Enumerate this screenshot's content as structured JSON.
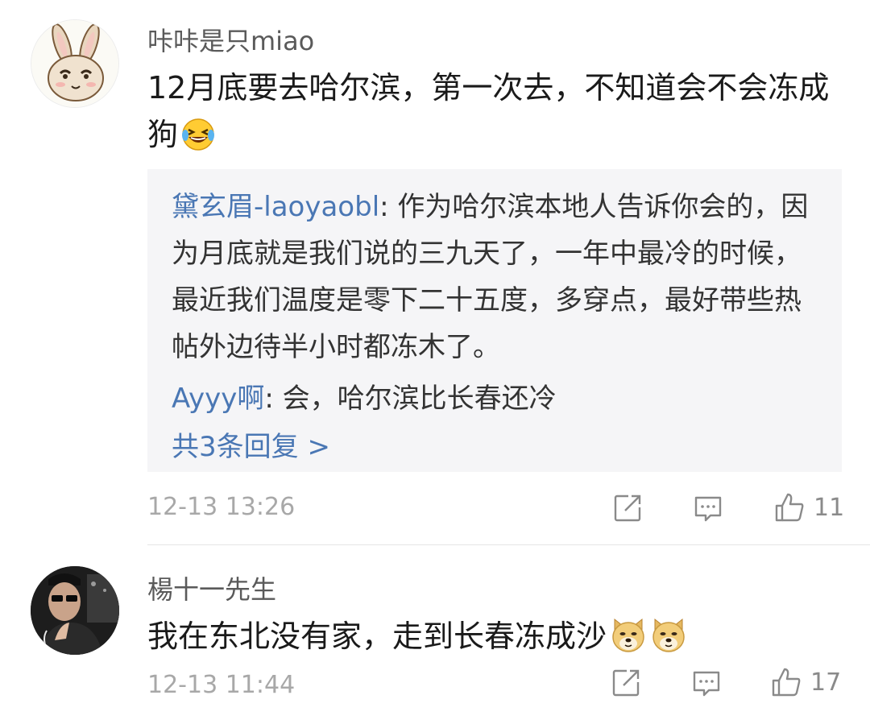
{
  "comments": [
    {
      "username": "咔咔是只miao",
      "text": "12月底要去哈尔滨，第一次去，不知道会不会冻成狗",
      "emoji_icon": "laughing-tears-icon",
      "replies": [
        {
          "author": "黛玄眉-laoyaobl",
          "separator": ": ",
          "text": "作为哈尔滨本地人告诉你会的，因为月底就是我们说的三九天了，一年中最冷的时候，最近我们温度是零下二十五度，多穿点，最好带些热帖外边待半小时都冻木了。"
        },
        {
          "author": "Ayyy啊",
          "separator": ": ",
          "text": "会，哈尔滨比长春还冷"
        }
      ],
      "more_replies": "共3条回复 >",
      "time": "12-13 13:26",
      "likes": "11"
    },
    {
      "username": "楊十一先生",
      "text": "我在东北没有家，走到长春冻成沙",
      "emoji_icon": "doge-icon",
      "time": "12-13 11:44",
      "likes": "17"
    }
  ],
  "colors": {
    "link": "#4a77b4",
    "reply_bg": "#f5f5f7",
    "meta": "#a8a8a8"
  }
}
